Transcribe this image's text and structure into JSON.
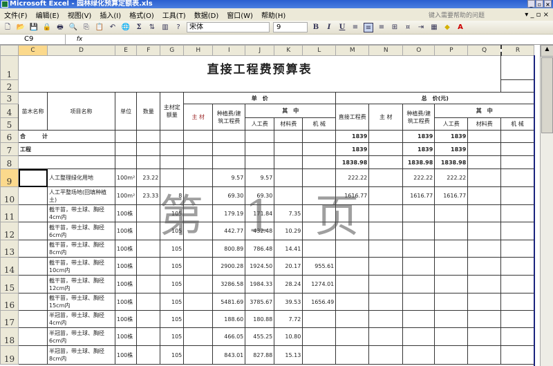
{
  "window": {
    "title": "Microsoft Excel - 园林绿化预算定额表.xls",
    "controls": [
      "_",
      "▫",
      "×"
    ]
  },
  "menu": {
    "items": [
      "文件(F)",
      "编辑(E)",
      "视图(V)",
      "插入(I)",
      "格式(O)",
      "工具(T)",
      "数据(D)",
      "窗口(W)",
      "帮助(H)"
    ],
    "help_placeholder": "键入需要帮助的问题",
    "mdi_controls": "▾ _ ▫ ×"
  },
  "toolbar": {
    "font": "宋体",
    "size": "9",
    "bold": "B",
    "italic": "I",
    "underline": "U",
    "sum": "Σ"
  },
  "formula": {
    "cell_ref": "C9",
    "fx": "fx",
    "value": ""
  },
  "columns": [
    "C",
    "D",
    "E",
    "F",
    "G",
    "H",
    "I",
    "J",
    "K",
    "L",
    "M",
    "N",
    "O",
    "P",
    "Q",
    "R"
  ],
  "rows": [
    "1",
    "2",
    "3",
    "4",
    "5",
    "6",
    "7",
    "8",
    "9",
    "10",
    "11",
    "12",
    "13",
    "14",
    "15",
    "16",
    "17",
    "18",
    "19"
  ],
  "sheet": {
    "title": "直接工程费预算表",
    "h": {
      "nursery": "苗木名称",
      "item": "项目名称",
      "unit": "单位",
      "qty": "数量",
      "main_quota": "主材定额量",
      "unit_price": "单　价",
      "main_mat": "主 材",
      "planting": "种植费/建筑工程费",
      "of_which": "其　中",
      "labor": "人工费",
      "material": "材料费",
      "machine": "机 械",
      "total": "总　价(元)",
      "direct": "直接工程费",
      "main_mat2": "主 材",
      "planting2": "种植费/建筑工程费",
      "of_which2": "其　中",
      "labor2": "人工费",
      "material2": "材料费",
      "machine2": "机 械"
    },
    "r6": {
      "label": "合　　　计",
      "M": "1839",
      "O": "1839",
      "P": "1839"
    },
    "r7": {
      "label": "工程",
      "M": "1839",
      "O": "1839",
      "P": "1839"
    },
    "r8": {
      "M": "1838.98",
      "O": "1838.98",
      "P": "1838.98"
    },
    "items": [
      {
        "D": "人工整理绿化用地",
        "E": "100m²",
        "F": "23.22",
        "G": "",
        "I": "9.57",
        "J": "9.57",
        "K": "",
        "L": "",
        "M": "222.22",
        "O": "222.22",
        "P": "222.22"
      },
      {
        "D": "人工平整场地(回填种植土)",
        "E": "100m²",
        "F": "23.33",
        "G": "8",
        "I": "69.30",
        "J": "69.30",
        "K": "",
        "L": "",
        "M": "1616.77",
        "O": "1616.77",
        "P": "1616.77"
      },
      {
        "D": "截干苗，带土球、胸径4cm内",
        "E": "100株",
        "F": "",
        "G": "105",
        "I": "179.19",
        "J": "171.84",
        "K": "7.35",
        "L": "",
        "M": "",
        "O": "",
        "P": ""
      },
      {
        "D": "截干苗，带土球、胸径6cm内",
        "E": "100株",
        "F": "",
        "G": "105",
        "I": "442.77",
        "J": "432.48",
        "K": "10.29",
        "L": "",
        "M": "",
        "O": "",
        "P": ""
      },
      {
        "D": "截干苗，带土球、胸径8cm内",
        "E": "100株",
        "F": "",
        "G": "105",
        "I": "800.89",
        "J": "786.48",
        "K": "14.41",
        "L": "",
        "M": "",
        "O": "",
        "P": ""
      },
      {
        "D": "截干苗，带土球、胸径10cm内",
        "E": "100株",
        "F": "",
        "G": "105",
        "I": "2900.28",
        "J": "1924.50",
        "K": "20.17",
        "L": "955.61",
        "M": "",
        "O": "",
        "P": ""
      },
      {
        "D": "截干苗，带土球、胸径12cm内",
        "E": "100株",
        "F": "",
        "G": "105",
        "I": "3286.58",
        "J": "1984.33",
        "K": "28.24",
        "L": "1274.01",
        "M": "",
        "O": "",
        "P": ""
      },
      {
        "D": "截干苗，带土球、胸径15cm内",
        "E": "100株",
        "F": "",
        "G": "105",
        "I": "5481.69",
        "J": "3785.67",
        "K": "39.53",
        "L": "1656.49",
        "M": "",
        "O": "",
        "P": ""
      },
      {
        "D": "半冠苗，带土球、胸径4cm内",
        "E": "100株",
        "F": "",
        "G": "105",
        "I": "188.60",
        "J": "180.88",
        "K": "7.72",
        "L": "",
        "M": "",
        "O": "",
        "P": ""
      },
      {
        "D": "半冠苗，带土球、胸径6cm内",
        "E": "100株",
        "F": "",
        "G": "105",
        "I": "466.05",
        "J": "455.25",
        "K": "10.80",
        "L": "",
        "M": "",
        "O": "",
        "P": ""
      },
      {
        "D": "半冠苗，带土球、胸径8cm内",
        "E": "100株",
        "F": "",
        "G": "105",
        "I": "843.01",
        "J": "827.88",
        "K": "15.13",
        "L": "",
        "M": "",
        "O": "",
        "P": ""
      }
    ],
    "page_watermark": "第 1 页"
  }
}
